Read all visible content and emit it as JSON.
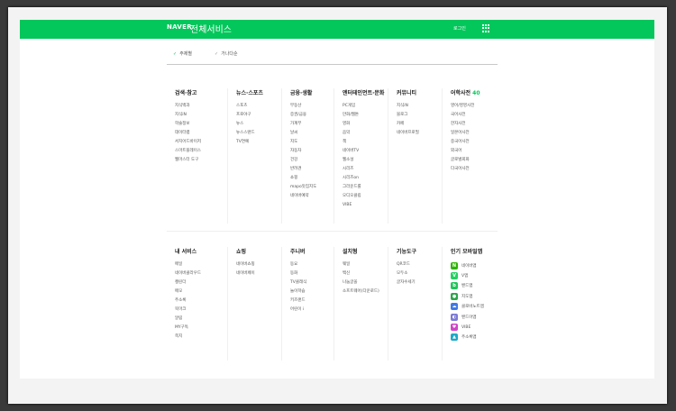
{
  "header": {
    "brand": "NAVER",
    "title": "전체서비스",
    "login_label": "로그인",
    "bar_color": "#03c75a"
  },
  "tabs": [
    {
      "label": "주제별"
    },
    {
      "label": "가나다순"
    }
  ],
  "sections_top": [
    {
      "title": "검색·참고",
      "items": [
        "지식백과",
        "지식iN",
        "학술정보",
        "데이터랩",
        "서치어드바이저",
        "스마트플레이스",
        "웹마스터 도구"
      ]
    },
    {
      "title": "뉴스·스포츠",
      "items": [
        "스포츠",
        "프로야구",
        "뉴스",
        "뉴스스탠드",
        "TV연예"
      ]
    },
    {
      "title": "금융·생활",
      "items": [
        "부동산",
        "증권/금융",
        "가계부",
        "날씨",
        "지도",
        "자동차",
        "건강",
        "반려견",
        "쇼핑",
        "mapo맛집지도",
        "네이버예약"
      ]
    },
    {
      "title": "엔터테인먼트·문화",
      "items": [
        "PC게임",
        "만화/웹툰",
        "영화",
        "음악",
        "책",
        "네이버TV",
        "웹소설",
        "시리즈",
        "시리즈on",
        "그라운드룰",
        "오디오클립",
        "VIBE"
      ]
    },
    {
      "title": "커뮤니티",
      "items": [
        "지식iN",
        "블로그",
        "카페",
        "네이버프로필"
      ]
    },
    {
      "title": "어학사전",
      "num": "40",
      "items": [
        "영어/영영사전",
        "국어사전",
        "한자사전",
        "일본어사전",
        "중국어사전",
        "외국어",
        "글로벌회화",
        "다국어사전"
      ]
    }
  ],
  "sections_bottom": [
    {
      "title": "내 서비스",
      "items": [
        "메일",
        "네이버클라우드",
        "캘린더",
        "메모",
        "주소록",
        "북마크",
        "알림",
        "MY구독",
        "쪽지"
      ]
    },
    {
      "title": "쇼핑",
      "items": [
        "네이버쇼핑",
        "네이버페이"
      ]
    },
    {
      "title": "주니버",
      "items": [
        "동요",
        "동화",
        "TV클래식",
        "놀이학습",
        "키즈랜드",
        "어린이 i"
      ]
    },
    {
      "title": "설치형",
      "items": [
        "웨일",
        "백신",
        "나눔글꼴",
        "소프트웨어(다운로드)"
      ]
    },
    {
      "title": "기능도구",
      "items": [
        "QR코드",
        "모두소",
        "글자수세기"
      ]
    },
    {
      "title": "인기 모바일앱",
      "apps": [
        {
          "label": "네이버앱",
          "icon": "naver-app-icon",
          "glyph": "N",
          "color": "#2db400"
        },
        {
          "label": "V앱",
          "icon": "v-app-icon",
          "glyph": "V",
          "color": "#23d160"
        },
        {
          "label": "밴드앱",
          "icon": "band-app-icon",
          "glyph": "b",
          "color": "#1fc55a"
        },
        {
          "label": "지도앱",
          "icon": "map-app-icon",
          "glyph": "●",
          "color": "#2aa64a"
        },
        {
          "label": "클로바노트앱",
          "icon": "clova-note-icon",
          "glyph": "☁",
          "color": "#3e7ae8"
        },
        {
          "label": "밴드아앱",
          "icon": "papago-app-icon",
          "glyph": "◐",
          "color": "#7b7bd6"
        },
        {
          "label": "VIBE",
          "icon": "vibe-app-icon",
          "glyph": "♥",
          "color": "#d043c8"
        },
        {
          "label": "주소록앱",
          "icon": "contacts-app-icon",
          "glyph": "▲",
          "color": "#1da8c7"
        }
      ]
    }
  ]
}
